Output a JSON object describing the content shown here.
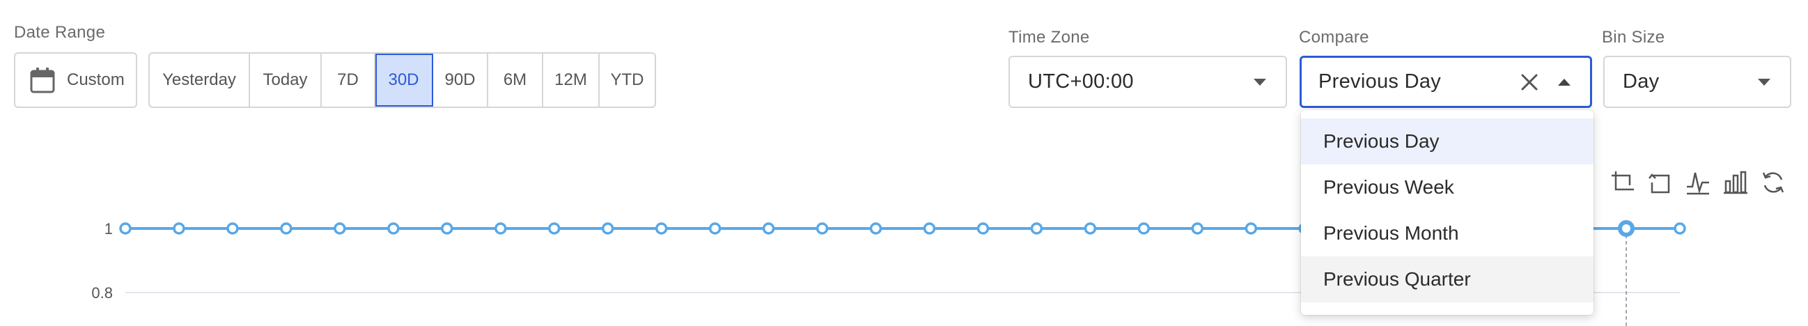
{
  "filters": {
    "date_range_label": "Date Range",
    "custom_label": "Custom",
    "ranges": [
      {
        "label": "Yesterday",
        "active": false
      },
      {
        "label": "Today",
        "active": false
      },
      {
        "label": "7D",
        "active": false
      },
      {
        "label": "30D",
        "active": true
      },
      {
        "label": "90D",
        "active": false
      },
      {
        "label": "6M",
        "active": false
      },
      {
        "label": "12M",
        "active": false
      },
      {
        "label": "YTD",
        "active": false
      }
    ],
    "time_zone_label": "Time Zone",
    "time_zone_value": "UTC+00:00",
    "compare_label": "Compare",
    "compare_value": "Previous Day",
    "compare_options": [
      "Previous Day",
      "Previous Week",
      "Previous Month",
      "Previous Quarter"
    ],
    "bin_size_label": "Bin Size",
    "bin_size_value": "Day"
  },
  "toolbox": [
    "crop-zoom-icon",
    "zoom-reset-icon",
    "line-chart-icon",
    "bar-chart-icon",
    "refresh-icon"
  ],
  "colors": {
    "accent": "#2d5bd7",
    "active_bg": "#d2e0fb",
    "series": "#58a8e8"
  },
  "chart_data": {
    "type": "line",
    "y_ticks": [
      "1",
      "0.8"
    ],
    "series": [
      {
        "values": [
          1,
          1,
          1,
          1,
          1,
          1,
          1,
          1,
          1,
          1,
          1,
          1,
          1,
          1,
          1,
          1,
          1,
          1,
          1,
          1,
          1,
          1,
          1,
          1,
          1,
          1,
          1,
          1,
          1,
          1
        ]
      }
    ],
    "ylim": [
      0.8,
      1
    ],
    "highlight_index": 28,
    "grid": true
  }
}
